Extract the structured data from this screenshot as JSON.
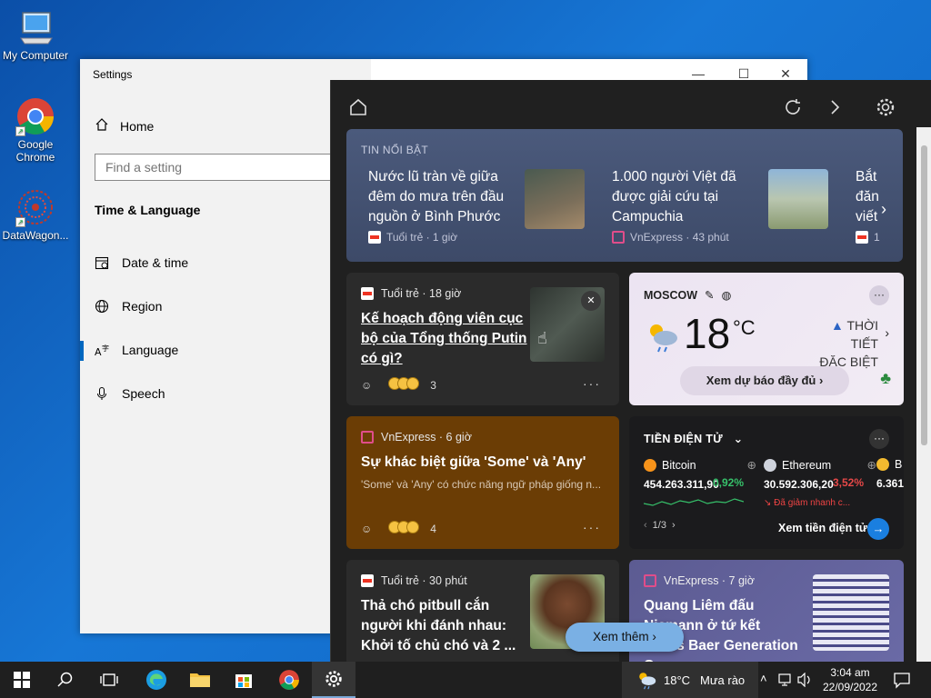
{
  "desktop": {
    "icons": [
      {
        "label": "My Computer"
      },
      {
        "label": "Google Chrome"
      },
      {
        "label": "DataWagon..."
      }
    ]
  },
  "settings": {
    "title": "Settings",
    "home": "Home",
    "search_placeholder": "Find a setting",
    "section": "Time & Language",
    "nav": [
      {
        "label": "Date & time"
      },
      {
        "label": "Region"
      },
      {
        "label": "Language"
      },
      {
        "label": "Speech"
      }
    ]
  },
  "news_panel": {
    "hero": {
      "label": "TIN NỔI BẬT",
      "items": [
        {
          "headline": "Nước lũ tràn về giữa đêm do mưa trên đầu nguồn ở Bình Phước",
          "source": "Tuổi trẻ · 1 giờ"
        },
        {
          "headline": "1.000 người Việt đã được giải cứu tại Campuchia",
          "source": "VnExpress · 43 phút"
        },
        {
          "headline": "Bắt đăn viết",
          "source": "1"
        }
      ]
    },
    "card1": {
      "source": "Tuổi trẻ · 18 giờ",
      "headline": "Kế hoạch động viên cục bộ của Tổng thống Putin có gì?",
      "reactions": "3"
    },
    "card2": {
      "source": "VnExpress · 6 giờ",
      "headline": "Sự khác biệt giữa 'Some' và 'Any'",
      "summary": "'Some' và 'Any' có chức năng ngữ pháp giống n...",
      "reactions": "4"
    },
    "card3": {
      "source": "Tuổi trẻ · 30 phút",
      "headline": "Thả chó pitbull cắn người khi đánh nhau: Khởi tố chủ chó và 2 ..."
    },
    "weather": {
      "city": "MOSCOW",
      "temp": "18",
      "unit": "°C",
      "alert_line1": "THỜI TIẾT",
      "alert_line2": "ĐẶC BIỆT",
      "forecast_btn": "Xem dự báo đầy đủ"
    },
    "crypto": {
      "header": "TIỀN ĐIỆN TỬ",
      "coins": [
        {
          "name": "Bitcoin",
          "value": "454.263.311,90",
          "change": "0,92%",
          "color": "#f7931a"
        },
        {
          "name": "Ethereum",
          "value": "30.592.306,20",
          "change": "3,52%",
          "note": "Đã giảm nhanh c...",
          "color": "#cfd3dc"
        },
        {
          "name": "B",
          "value": "6.361",
          "color": "#f3ba2f"
        }
      ],
      "pager": "1/3",
      "see_all": "Xem tiền điện tử"
    },
    "sports": {
      "source": "VnExpress · 7 giờ",
      "headline": "Quang Liêm đấu Niemann ở tứ kết Julius Baer Generation Cup"
    },
    "see_more": "Xem thêm"
  },
  "taskbar": {
    "weather_temp": "18°C",
    "weather_desc": "Mưa rào",
    "time": "3:04 am",
    "date": "22/09/2022"
  }
}
